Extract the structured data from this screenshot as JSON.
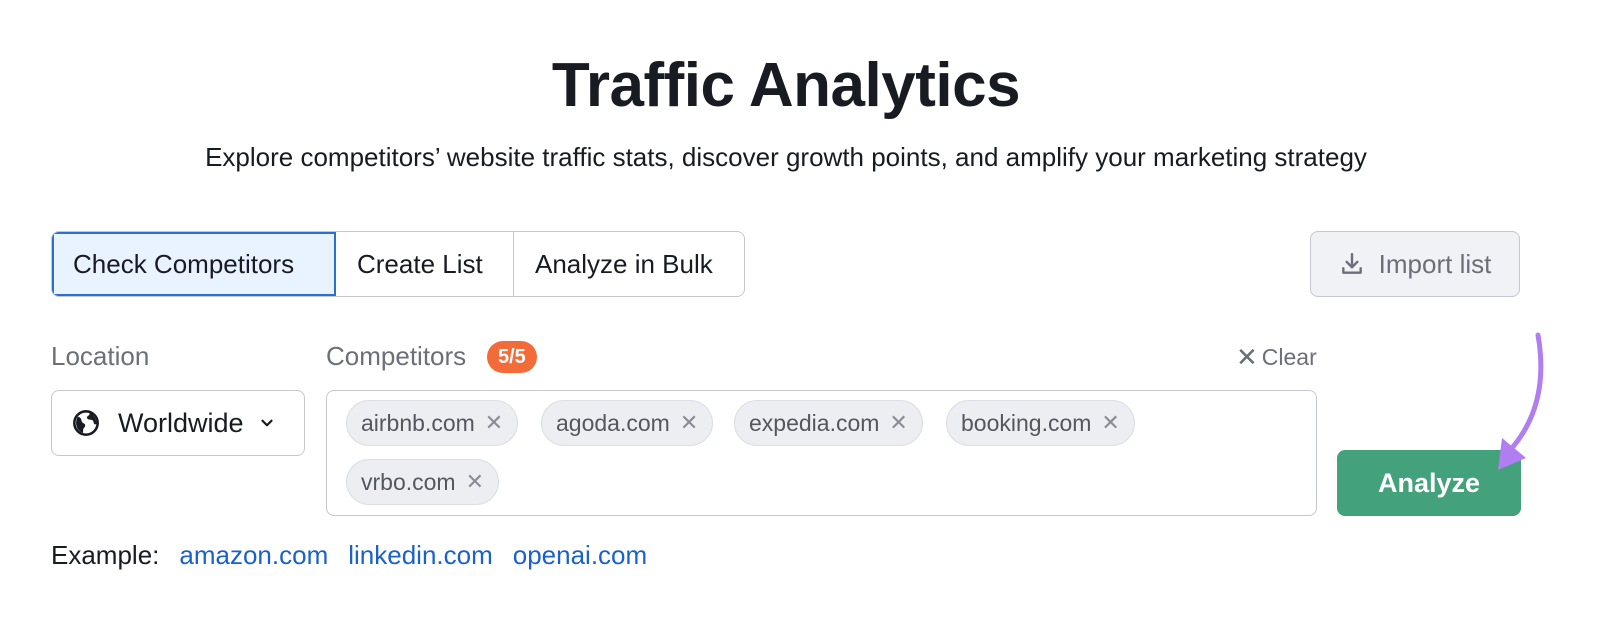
{
  "header": {
    "title": "Traffic Analytics",
    "subtitle": "Explore competitors’ website traffic stats, discover growth points, and amplify your marketing strategy"
  },
  "tabs": [
    {
      "label": "Check Competitors",
      "active": true
    },
    {
      "label": "Create List",
      "active": false
    },
    {
      "label": "Analyze in Bulk",
      "active": false
    }
  ],
  "import": {
    "label": "Import list",
    "icon": "download-icon"
  },
  "location": {
    "label": "Location",
    "value": "Worldwide",
    "icon": "globe-icon"
  },
  "competitors": {
    "label": "Competitors",
    "count": "5/5",
    "clear_label": "Clear",
    "chips": [
      {
        "domain": "airbnb.com"
      },
      {
        "domain": "agoda.com"
      },
      {
        "domain": "expedia.com"
      },
      {
        "domain": "booking.com"
      },
      {
        "domain": "vrbo.com"
      }
    ]
  },
  "analyze": {
    "label": "Analyze"
  },
  "examples": {
    "label": "Example:",
    "links": [
      "amazon.com",
      "linkedin.com",
      "openai.com"
    ]
  },
  "colors": {
    "accent_green": "#43a17b",
    "badge_orange": "#f26b38",
    "link_blue": "#1a62c9",
    "arrow_purple": "#b07ef0"
  }
}
